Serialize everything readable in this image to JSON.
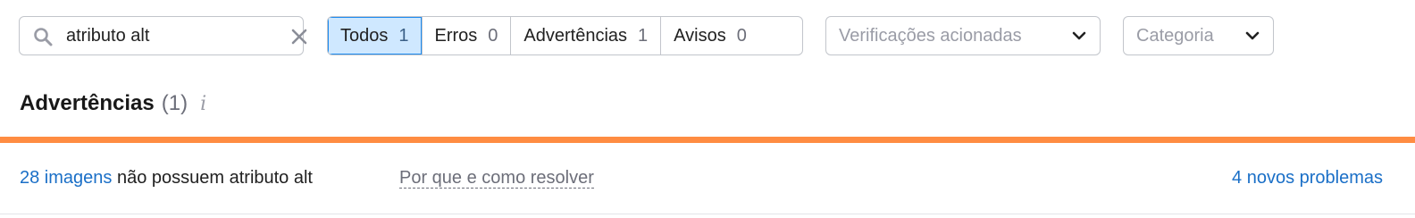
{
  "search": {
    "value": "atributo alt",
    "icon": "search-icon",
    "clear_icon": "close-icon"
  },
  "filters": [
    {
      "label": "Todos",
      "count": "1",
      "active": true
    },
    {
      "label": "Erros",
      "count": "0",
      "active": false
    },
    {
      "label": "Advertências",
      "count": "1",
      "active": false
    },
    {
      "label": "Avisos",
      "count": "0",
      "active": false
    }
  ],
  "dropdowns": {
    "checks": {
      "label": "Verificações acionadas",
      "icon": "chevron-down-icon"
    },
    "category": {
      "label": "Categoria",
      "icon": "chevron-down-icon"
    }
  },
  "section": {
    "title": "Advertências",
    "count": "(1)",
    "info_icon": "i"
  },
  "colors": {
    "accent": "#ff8c42",
    "link": "#1a6fc7",
    "active_filter_bg": "#cfe8ff",
    "active_filter_border": "#1f8cf0"
  },
  "issue": {
    "link_text": "28 imagens",
    "rest_text": " não possuem atributo alt",
    "why_link": "Por que e como resolver",
    "new_issues": "4 novos problemas"
  }
}
